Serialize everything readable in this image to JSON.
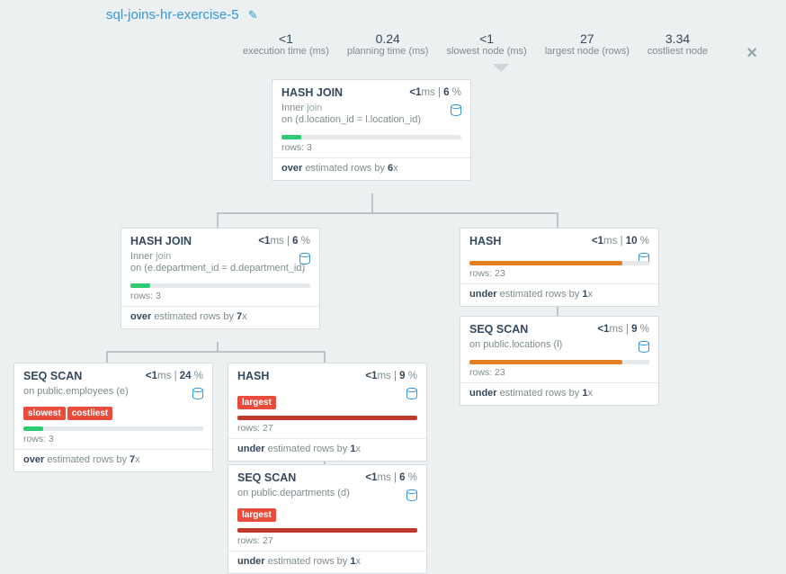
{
  "title": "sql-joins-hr-exercise-5",
  "stats": [
    {
      "val": "<1",
      "lbl": "execution time (ms)"
    },
    {
      "val": "0.24",
      "lbl": "planning time (ms)"
    },
    {
      "val": "<1",
      "lbl": "slowest node (ms)"
    },
    {
      "val": "27",
      "lbl": "largest node (rows)"
    },
    {
      "val": "3.34",
      "lbl": "costliest node"
    }
  ],
  "nodes": {
    "n1": {
      "name": "HASH JOIN",
      "ms": "<1",
      "pct": "6",
      "sub1": "Inner",
      "sub1_kw": "join",
      "on": "on (d.location_id = l.location_id)",
      "rows": "3",
      "est_dir": "over",
      "est_x": "6"
    },
    "n2": {
      "name": "HASH JOIN",
      "ms": "<1",
      "pct": "6",
      "sub1": "Inner",
      "sub1_kw": "join",
      "on": "on (e.department_id = d.department_id)",
      "rows": "3",
      "est_dir": "over",
      "est_x": "7"
    },
    "n3": {
      "name": "HASH",
      "ms": "<1",
      "pct": "10",
      "rows": "23",
      "est_dir": "under",
      "est_x": "1"
    },
    "n4": {
      "name": "SEQ SCAN",
      "ms": "<1",
      "pct": "9",
      "on": "on public.locations (l)",
      "rows": "23",
      "est_dir": "under",
      "est_x": "1"
    },
    "n5": {
      "name": "SEQ SCAN",
      "ms": "<1",
      "pct": "24",
      "on": "on public.employees (e)",
      "tags": [
        "slowest",
        "costliest"
      ],
      "rows": "3",
      "est_dir": "over",
      "est_x": "7"
    },
    "n6": {
      "name": "HASH",
      "ms": "<1",
      "pct": "9",
      "tags": [
        "largest"
      ],
      "rows": "27",
      "est_dir": "under",
      "est_x": "1"
    },
    "n7": {
      "name": "SEQ SCAN",
      "ms": "<1",
      "pct": "6",
      "on": "on public.departments (d)",
      "tags": [
        "largest"
      ],
      "rows": "27",
      "est_dir": "under",
      "est_x": "1"
    }
  },
  "labels": {
    "rows": "rows:",
    "ms": "ms",
    "est_mid": "estimated rows by",
    "x": "x"
  }
}
